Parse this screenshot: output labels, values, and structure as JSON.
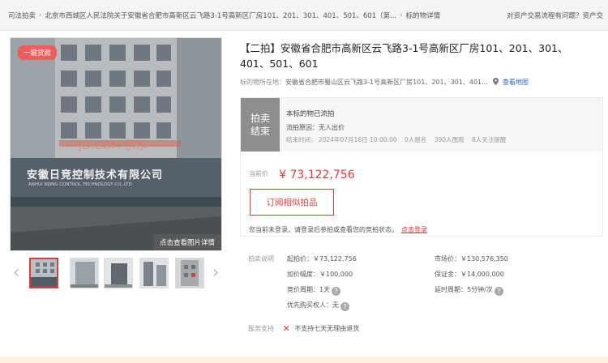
{
  "breadcrumb": {
    "items": [
      "司法拍卖",
      "北京市西城区人民法院关于安徽省合肥市高新区云飞路3-1号高新区厂房101、201、301、401、501、601（第...",
      "标的物详情"
    ],
    "right_text": "对资产交易流程有问题？资产交"
  },
  "gallery": {
    "loan_tag": "一键贷款",
    "zoom_tip": "点击查看图片详情",
    "sign_text": "安徽日竞控制技术有限公司",
    "sign_sub": "ANHUI RIJING CONTROL TECHNOLOGY CO.,LTD",
    "watermark": "JD.COM 京东",
    "thumb_count": 5
  },
  "item": {
    "title": "【二拍】安徽省合肥市高新区云飞路3-1号高新区厂房101、201、301、401、501、601",
    "location_label": "标的物所在地：",
    "location_value": "安徽省合肥市蜀山区云飞路3-1号高新区厂房101、201、301、401...",
    "map_link": "查看地图"
  },
  "status": {
    "badge_line1": "拍卖",
    "badge_line2": "结束",
    "headline": "本标的物已流拍",
    "reason": "流拍原因：无人出价",
    "end_time": "结束时间： 2024年07月16日 10:00:00",
    "enrolled": "0人报名",
    "views": "390人围观",
    "followers": "8人关注提醒"
  },
  "price": {
    "label": "当前价",
    "value": "¥ 73,122,756"
  },
  "subscribe_label": "订阅相似拍品",
  "login_tip": {
    "text": "您当前未登录，请登录后参拍或查看您的竞拍状态。",
    "link": "点击登录"
  },
  "details": {
    "section_label": "拍卖说明",
    "start_price": "起拍价：￥73,122,756",
    "market_price": "市场价：￥130,576,350",
    "increment": "加价幅度：￥100,000",
    "deposit": "保证金：￥14,000,000",
    "bid_cycle": "竞价周期：1天",
    "delay_cycle": "延时周期：5分钟/次",
    "priority_buyer": "优先购买权人：无"
  },
  "service": {
    "label": "服务支持",
    "text": "不支持七天无理由退货"
  },
  "colors": {
    "accent": "#e4393c",
    "link": "#2a62c8",
    "status_gray": "#8e8e8e"
  }
}
